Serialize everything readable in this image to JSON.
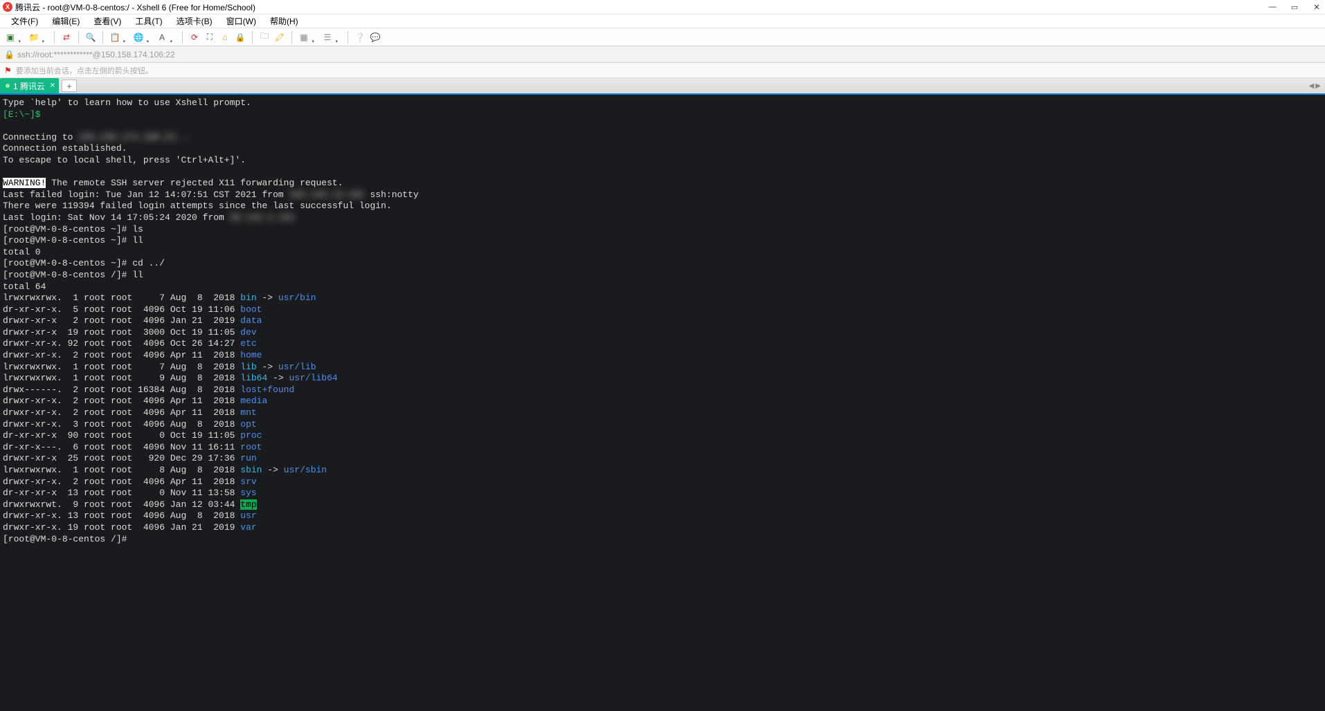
{
  "titlebar": {
    "title": "腾讯云 - root@VM-0-8-centos:/ - Xshell 6 (Free for Home/School)"
  },
  "menu": {
    "file": "文件(F)",
    "edit": "编辑(E)",
    "view": "查看(V)",
    "tools": "工具(T)",
    "tab": "选项卡(B)",
    "window": "窗口(W)",
    "help": "帮助(H)"
  },
  "addrbar": {
    "url": "ssh://root:************@150.158.174.106:22"
  },
  "hintbar": {
    "text": "要添加当前会话，点击左侧的箭头按钮。"
  },
  "tab": {
    "label": "1 腾讯云"
  },
  "term": {
    "l1": "Type `help' to learn how to use Xshell prompt.",
    "l2": "[E:\\~]$",
    "l3": "Connecting to ",
    "l3b": "150.158.174.106:22...",
    "l4": "Connection established.",
    "l5": "To escape to local shell, press 'Ctrl+Alt+]'.",
    "warn": "WARNING!",
    "l6": " The remote SSH server rejected X11 forwarding request.",
    "l7a": "Last failed login: Tue Jan 12 14:07:51 CST 2021 from ",
    "l7b": "103.145.13.201",
    "l7c": " ssh:notty",
    "l8a": "There were 119394 failed login attempts since the last successful login.",
    "l9a": "Last login: Sat Nov 14 17:05:24 2020 from ",
    "l9b": "39.144.4.232",
    "p1": "[root@VM-0-8-centos ~]# ",
    "cmd_ls": "ls",
    "cmd_ll": "ll",
    "total0": "total 0",
    "cmd_cd": "cd ../",
    "p2": "[root@VM-0-8-centos /]# ",
    "total64": "total 64",
    "rows": [
      {
        "p": "lrwxrwxrwx.  1 root root     7 Aug  8  2018 ",
        "n": "bin",
        "arrow": " -> ",
        "t": "usr/bin",
        "nc": "c-cyan",
        "tc": "c-blue"
      },
      {
        "p": "dr-xr-xr-x.  5 root root  4096 Oct 19 11:06 ",
        "n": "boot",
        "nc": "c-blue"
      },
      {
        "p": "drwxr-xr-x   2 root root  4096 Jan 21  2019 ",
        "n": "data",
        "nc": "c-blue"
      },
      {
        "p": "drwxr-xr-x  19 root root  3000 Oct 19 11:05 ",
        "n": "dev",
        "nc": "c-blue"
      },
      {
        "p": "drwxr-xr-x. 92 root root  4096 Oct 26 14:27 ",
        "n": "etc",
        "nc": "c-blue"
      },
      {
        "p": "drwxr-xr-x.  2 root root  4096 Apr 11  2018 ",
        "n": "home",
        "nc": "c-blue"
      },
      {
        "p": "lrwxrwxrwx.  1 root root     7 Aug  8  2018 ",
        "n": "lib",
        "arrow": " -> ",
        "t": "usr/lib",
        "nc": "c-cyan",
        "tc": "c-blue"
      },
      {
        "p": "lrwxrwxrwx.  1 root root     9 Aug  8  2018 ",
        "n": "lib64",
        "arrow": " -> ",
        "t": "usr/lib64",
        "nc": "c-cyan",
        "tc": "c-blue"
      },
      {
        "p": "drwx------.  2 root root 16384 Aug  8  2018 ",
        "n": "lost+found",
        "nc": "c-blue"
      },
      {
        "p": "drwxr-xr-x.  2 root root  4096 Apr 11  2018 ",
        "n": "media",
        "nc": "c-blue"
      },
      {
        "p": "drwxr-xr-x.  2 root root  4096 Apr 11  2018 ",
        "n": "mnt",
        "nc": "c-blue"
      },
      {
        "p": "drwxr-xr-x.  3 root root  4096 Aug  8  2018 ",
        "n": "opt",
        "nc": "c-blue"
      },
      {
        "p": "dr-xr-xr-x  90 root root     0 Oct 19 11:05 ",
        "n": "proc",
        "nc": "c-blue"
      },
      {
        "p": "dr-xr-x---.  6 root root  4096 Nov 11 16:11 ",
        "n": "root",
        "nc": "c-blue"
      },
      {
        "p": "drwxr-xr-x  25 root root   920 Dec 29 17:36 ",
        "n": "run",
        "nc": "c-blue"
      },
      {
        "p": "lrwxrwxrwx.  1 root root     8 Aug  8  2018 ",
        "n": "sbin",
        "arrow": " -> ",
        "t": "usr/sbin",
        "nc": "c-cyan",
        "tc": "c-blue"
      },
      {
        "p": "drwxr-xr-x.  2 root root  4096 Apr 11  2018 ",
        "n": "srv",
        "nc": "c-blue"
      },
      {
        "p": "dr-xr-xr-x  13 root root     0 Nov 11 13:58 ",
        "n": "sys",
        "nc": "c-blue"
      },
      {
        "p": "drwxrwxrwt.  9 root root  4096 Jan 12 03:44 ",
        "n": "tmp",
        "nc": "c-hl"
      },
      {
        "p": "drwxr-xr-x. 13 root root  4096 Aug  8  2018 ",
        "n": "usr",
        "nc": "c-blue"
      },
      {
        "p": "drwxr-xr-x. 19 root root  4096 Jan 21  2019 ",
        "n": "var",
        "nc": "c-blue"
      }
    ]
  }
}
